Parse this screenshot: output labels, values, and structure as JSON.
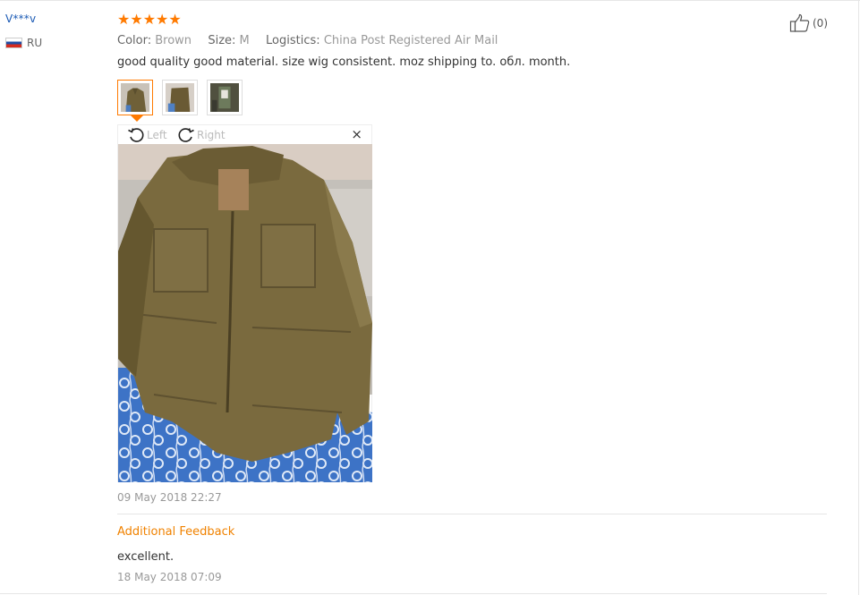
{
  "reviewer": {
    "name": "V***v",
    "country_code": "RU"
  },
  "rating": {
    "stars": 5,
    "max": 5,
    "star_glyph": "★",
    "color": "#ff7a00"
  },
  "attributes": [
    {
      "label": "Color:",
      "value": "Brown"
    },
    {
      "label": "Size:",
      "value": "M"
    },
    {
      "label": "Logistics:",
      "value": "China Post Registered Air Mail"
    }
  ],
  "review_text": "good quality good material. size wig consistent. moz shipping to. обл. month.",
  "thumbnails": [
    {
      "name": "photo-1",
      "active": true
    },
    {
      "name": "photo-2",
      "active": false
    },
    {
      "name": "photo-3",
      "active": false
    }
  ],
  "viewer": {
    "rotate_left_label": "Left",
    "rotate_right_label": "Right",
    "close_glyph": "×"
  },
  "review_date": "09 May 2018 22:27",
  "additional": {
    "heading": "Additional Feedback",
    "text": "excellent.",
    "date": "18 May 2018 07:09"
  },
  "helpful": {
    "count_label": "(0)",
    "icon": "thumbs-up-icon"
  },
  "colors": {
    "accent": "#ff7a00",
    "link": "#1c5bb5",
    "muted": "#999999"
  }
}
